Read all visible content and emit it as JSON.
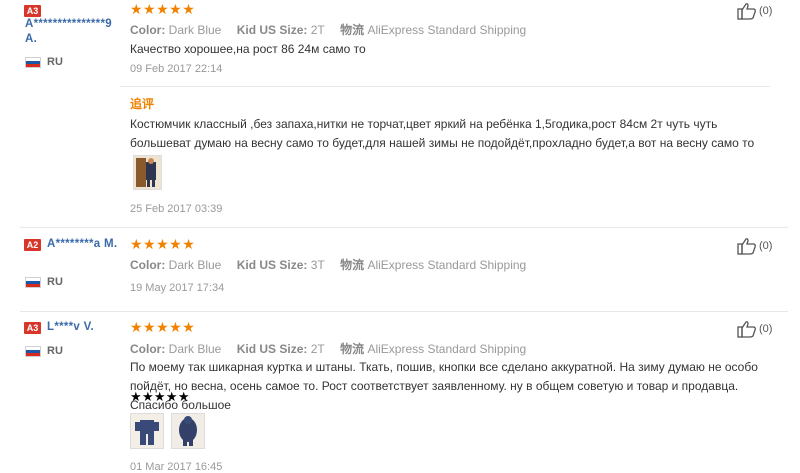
{
  "reviews": [
    {
      "badge": "A3",
      "user": "A***************9 A.",
      "country": "RU",
      "stars": "★★★★★",
      "color_label": "Color:",
      "color_value": "Dark Blue",
      "size_label": "Kid US Size:",
      "size_value": "2T",
      "ship_label": "物流",
      "ship_value": "AliExpress Standard Shipping",
      "text": "Качество хорошее,на рост 86 24м само то",
      "date": "09 Feb 2017 22:14",
      "likes": "(0)",
      "append": {
        "label": "追评",
        "text": "Костюмчик классный ,без запаха,нитки не торчат,цвет яркий на ребёнка 1,5годика,рост 84см 2т чуть чуть большеват думаю на весну само то будет,для нашей зимы не подойдёт,прохладно будет,а вот на весну само то",
        "date": "25 Feb 2017 03:39"
      }
    },
    {
      "badge": "A2",
      "user": "A********a M.",
      "country": "RU",
      "stars": "★★★★★",
      "color_label": "Color:",
      "color_value": "Dark Blue",
      "size_label": "Kid US Size:",
      "size_value": "3T",
      "ship_label": "物流",
      "ship_value": "AliExpress Standard Shipping",
      "date": "19 May 2017 17:34",
      "likes": "(0)"
    },
    {
      "badge": "A3",
      "user": "L****v V.",
      "country": "RU",
      "stars": "★★★★★",
      "color_label": "Color:",
      "color_value": "Dark Blue",
      "size_label": "Kid US Size:",
      "size_value": "2T",
      "ship_label": "物流",
      "ship_value": "AliExpress Standard Shipping",
      "text": "По моему так шикарная куртка и штаны. Ткать, пошив, кнопки все сделано аккуратной. На зиму думаю не особо пойдёт, но весна, осень самое то. Рост соответствует заявленному. ну в общем советую и товар и продавца. Спасибо большое",
      "text_stars": "★★★★★",
      "date": "01 Mar 2017 16:45",
      "likes": "(0)"
    }
  ],
  "colors": {
    "accent": "#f08200",
    "badge": "#d9362b",
    "username": "#3a6aa8"
  }
}
